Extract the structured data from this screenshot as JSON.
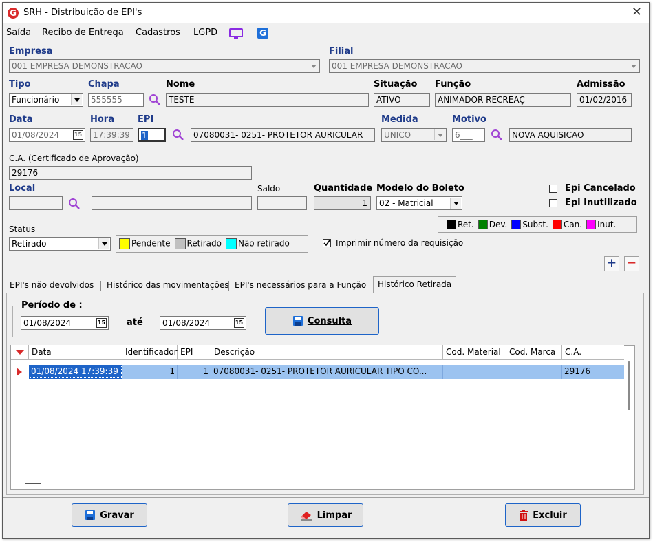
{
  "window": {
    "title": "SRH - Distribuição de EPI's"
  },
  "menu": [
    "Saída",
    "Recibo de Entrega",
    "Cadastros",
    "LGPD"
  ],
  "labels": {
    "empresa": "Empresa",
    "filial": "Filial",
    "tipo": "Tipo",
    "chapa": "Chapa",
    "nome": "Nome",
    "situacao": "Situação",
    "funcao": "Função",
    "admissao": "Admissão",
    "data": "Data",
    "hora": "Hora",
    "epi": "EPI",
    "medida": "Medida",
    "motivo": "Motivo",
    "ca": "C.A. (Certificado de Aprovação)",
    "local": "Local",
    "saldo": "Saldo",
    "quantidade": "Quantidade",
    "modelo_boleto": "Modelo do Boleto",
    "status": "Status",
    "periodo_de": "Período de :",
    "ate": "até"
  },
  "fields": {
    "empresa": "001 EMPRESA DEMONSTRACAO",
    "filial": "001 EMPRESA DEMONSTRACAO",
    "tipo": "Funcionário",
    "chapa": "555555",
    "nome": "TESTE",
    "situacao": "ATIVO",
    "funcao": "ANIMADOR RECREAÇ",
    "admissao": "01/02/2016",
    "data": "01/08/2024",
    "hora": "17:39:39",
    "epi": "1",
    "epi_desc": "07080031- 0251- PROTETOR AURICULAR",
    "medida": "UNICO",
    "motivo_code": "6___",
    "motivo_desc": "NOVA AQUISICAO",
    "ca": "29176",
    "local_code": "",
    "local_desc": "",
    "saldo": "",
    "quantidade": "1",
    "modelo_boleto": "02 - Matricial",
    "status": "Retirado",
    "periodo_de": "01/08/2024",
    "periodo_ate": "01/08/2024"
  },
  "checkboxes": {
    "epi_cancelado": {
      "label": "Epi Cancelado",
      "checked": false
    },
    "epi_inutilizado": {
      "label": "Epi Inutilizado",
      "checked": false
    },
    "imprimir_requisicao": {
      "label": "Imprimir número da requisição",
      "checked": true
    }
  },
  "calendar_glyph": "15",
  "status_legend": [
    {
      "label": "Pendente",
      "color": "#ffff00"
    },
    {
      "label": "Retirado",
      "color": "#c0c0c0"
    },
    {
      "label": "Não retirado",
      "color": "#00ffff"
    }
  ],
  "type_legend": [
    {
      "label": "Ret.",
      "color": "#000000"
    },
    {
      "label": "Dev.",
      "color": "#008000"
    },
    {
      "label": "Subst.",
      "color": "#0000ff"
    },
    {
      "label": "Can.",
      "color": "#ff0000"
    },
    {
      "label": "Inut.",
      "color": "#ff00ff"
    }
  ],
  "tabs": [
    "EPI's não devolvidos",
    "Histórico das movimentações",
    "EPI's necessários para a Função",
    "Histórico Retirada"
  ],
  "active_tab": 3,
  "buttons": {
    "consulta": "Consulta",
    "gravar": "Gravar",
    "limpar": "Limpar",
    "excluir": "Excluir",
    "add": "+",
    "remove": "−"
  },
  "grid": {
    "columns": [
      "Data",
      "Identificador",
      "EPI",
      "Descrição",
      "Cod. Material",
      "Cod. Marca",
      "C.A."
    ],
    "rows": [
      [
        "01/08/2024 17:39:39",
        "1",
        "1",
        "07080031- 0251- PROTETOR AURICULAR TIPO CO...",
        "",
        "",
        "29176"
      ]
    ]
  },
  "colors": {
    "label_blue": "#1f3b8a",
    "selection": "#9cc3f0",
    "accent_red": "#d92b2b"
  }
}
